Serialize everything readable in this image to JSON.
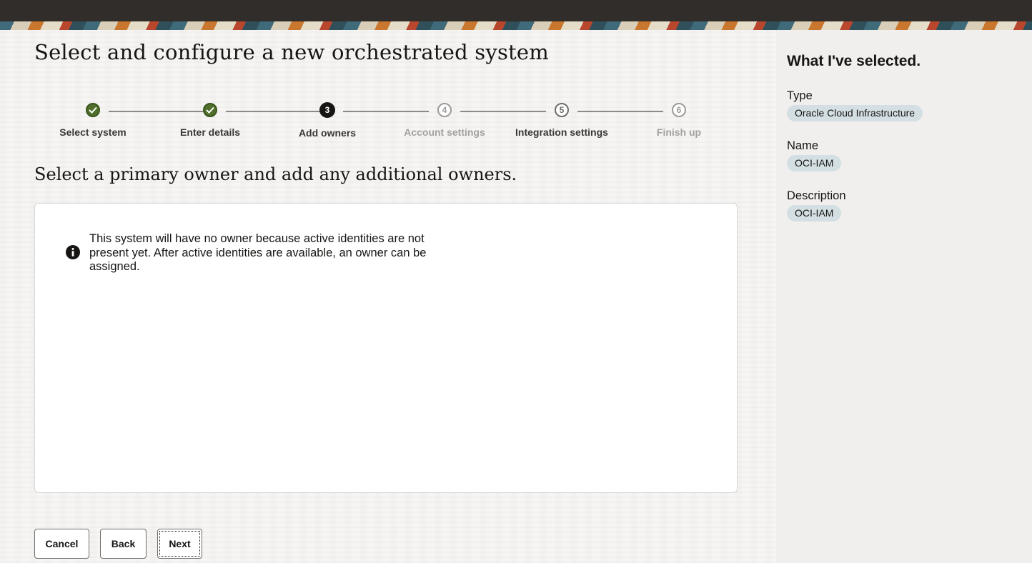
{
  "page": {
    "title": "Select and configure a new orchestrated system",
    "section_title": "Select a primary owner and add any additional owners."
  },
  "steps": [
    {
      "number": "1",
      "label": "Select system",
      "status": "completed"
    },
    {
      "number": "2",
      "label": "Enter details",
      "status": "completed"
    },
    {
      "number": "3",
      "label": "Add owners",
      "status": "current"
    },
    {
      "number": "4",
      "label": "Account settings",
      "status": "disabled"
    },
    {
      "number": "5",
      "label": "Integration settings",
      "status": "enabled"
    },
    {
      "number": "6",
      "label": "Finish up",
      "status": "disabled"
    }
  ],
  "info": {
    "icon": "info-icon",
    "message": "This system will have no owner because active identities are not present yet. After active identities are available, an owner can be assigned."
  },
  "buttons": {
    "cancel": "Cancel",
    "back": "Back",
    "next": "Next"
  },
  "sidebar": {
    "title": "What I've selected.",
    "items": [
      {
        "label": "Type",
        "value": "Oracle Cloud Infrastructure"
      },
      {
        "label": "Name",
        "value": "OCI-IAM"
      },
      {
        "label": "Description",
        "value": "OCI-IAM"
      }
    ]
  },
  "colors": {
    "topbar": "#312d2a",
    "completed_step": "#4f6f2a",
    "current_step": "#161513",
    "chip": "#d4dfe3",
    "sidebar_bg": "#f1efed"
  }
}
